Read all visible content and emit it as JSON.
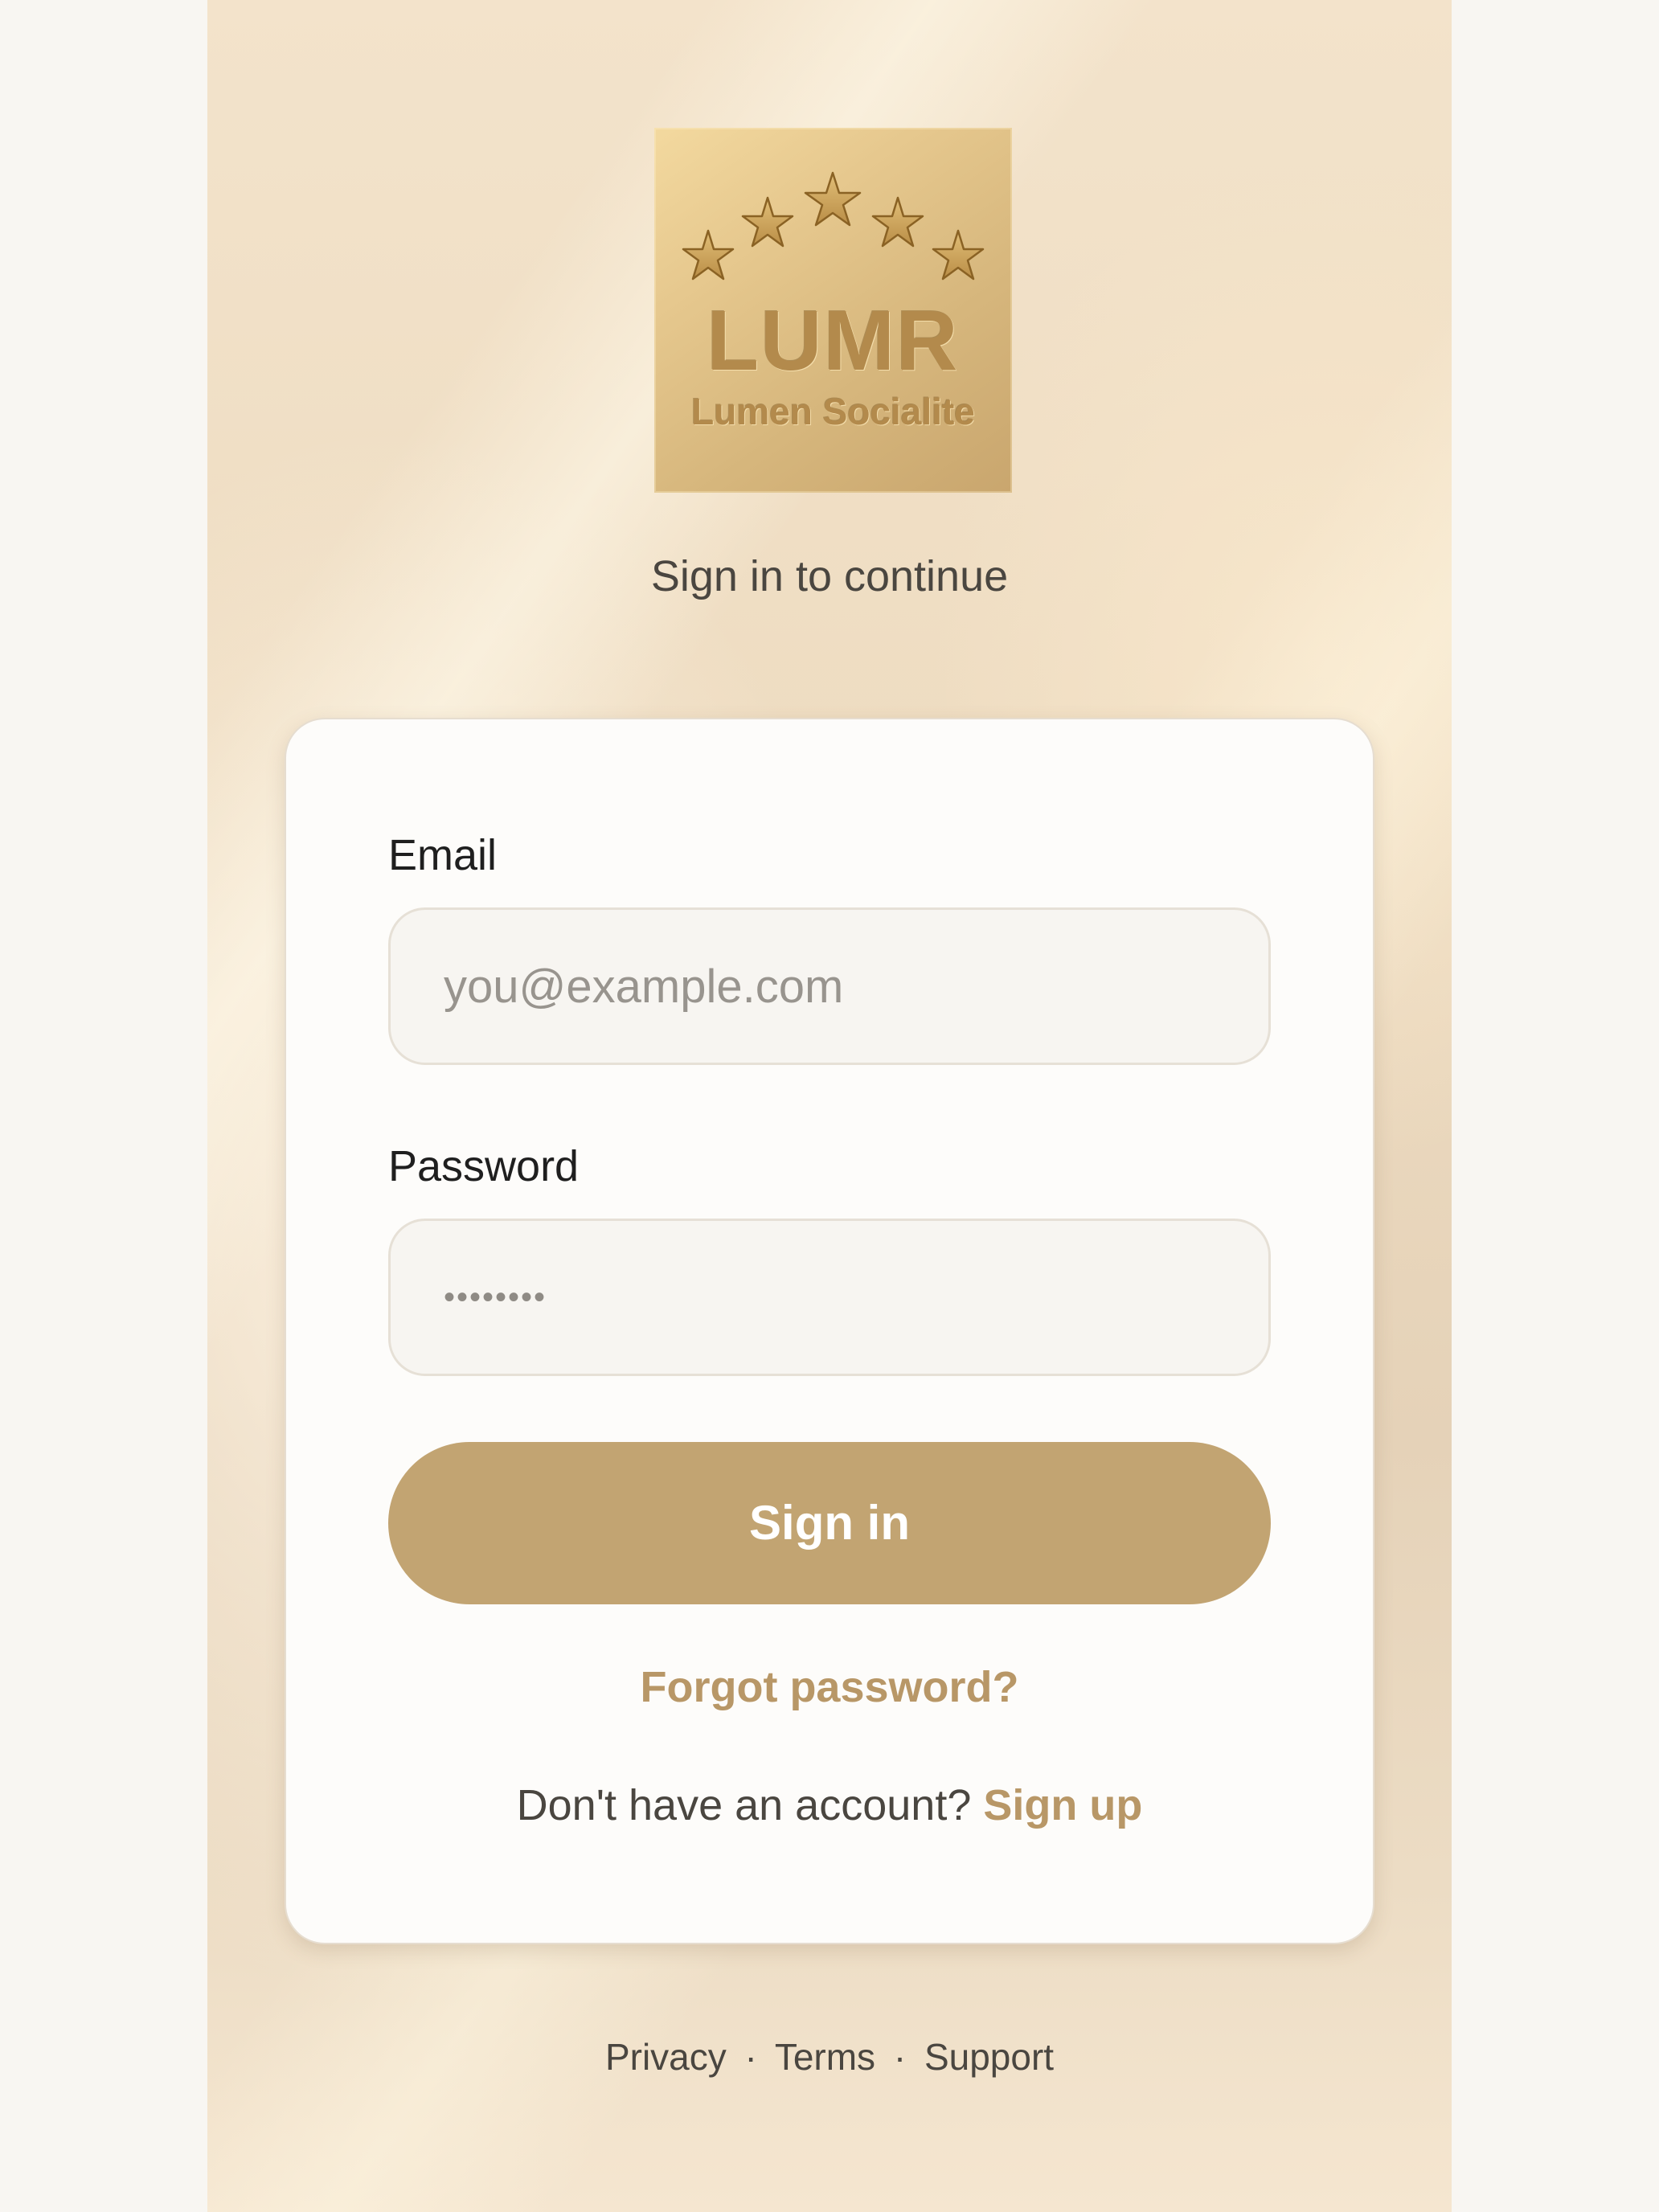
{
  "logo": {
    "title": "LUMR",
    "subtitle": "Lumen Socialite",
    "icon": "five-stars-emblem"
  },
  "header": {
    "subtitle": "Sign in to continue"
  },
  "form": {
    "email_label": "Email",
    "email_placeholder": "you@example.com",
    "email_value": "",
    "password_label": "Password",
    "password_masked": "••••••••",
    "signin_label": "Sign in",
    "forgot_label": "Forgot password?",
    "signup_prompt": "Don't have an account?",
    "signup_label": "Sign up"
  },
  "footer": {
    "links": [
      "Privacy",
      "Terms",
      "Support"
    ],
    "separator": "·"
  },
  "colors": {
    "accent": "#c2a472",
    "accent_text": "#b89767",
    "logo_gold": "#d6b67c"
  }
}
